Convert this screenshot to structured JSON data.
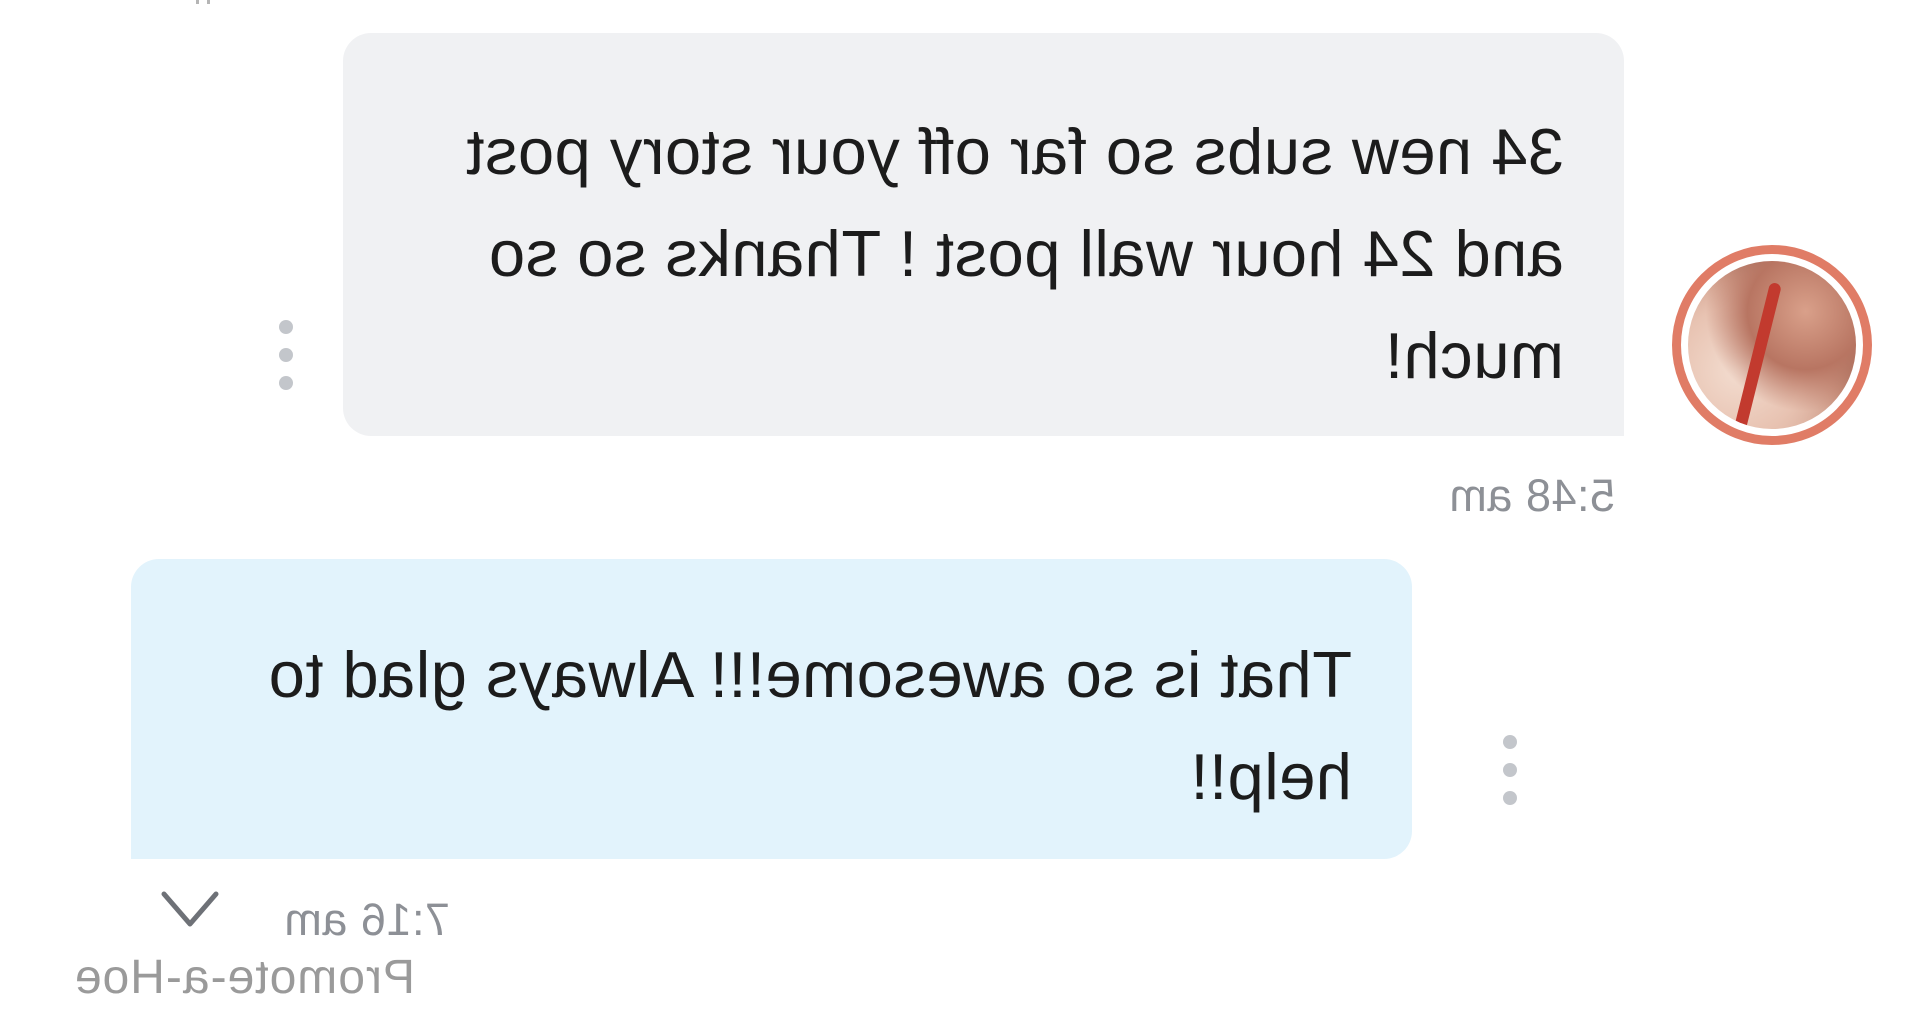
{
  "conversation": {
    "incoming": {
      "text": "34 new subs so far off your story post and 24 hour wall post ! Thanks so so much!",
      "timestamp": "5:48 am"
    },
    "outgoing": {
      "text": "That is so awesome!!! Always glad to help!!",
      "timestamp": "7:16 am"
    }
  },
  "icons": {
    "more": "more-vertical-icon",
    "chevron": "chevron-down-icon",
    "avatar": "avatar"
  },
  "colors": {
    "incoming_bubble": "#f0f1f3",
    "outgoing_bubble": "#e2f3fc",
    "avatar_ring": "#e07c66",
    "meta_text": "#8d9096"
  },
  "watermark": "Promote-a-Hoe"
}
